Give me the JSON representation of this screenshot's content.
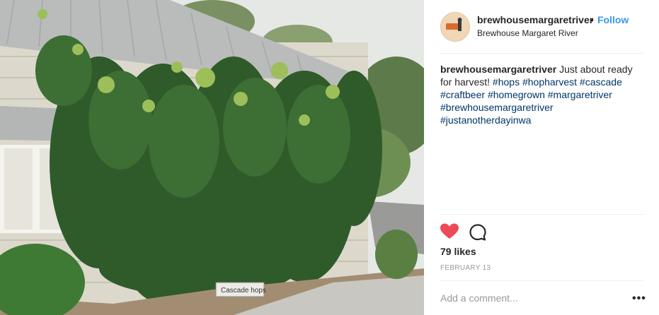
{
  "post": {
    "account": {
      "username": "brewhousemargaretriver",
      "separator": "•",
      "follow_label": "Follow",
      "location": "Brewhouse Margaret River",
      "avatar_icon": "brewhouse-logo-icon"
    },
    "caption": {
      "username": "brewhousemargaretriver",
      "text": "Just about ready for harvest!",
      "hashtags": [
        "#hops",
        "#hopharvest",
        "#cascade",
        "#craftbeer",
        "#homegrown",
        "#margaretriver",
        "#brewhousemargaretriver",
        "#justanotherdayinwa"
      ]
    },
    "actions": {
      "like_icon": "heart-filled-icon",
      "comment_icon": "comment-bubble-icon",
      "liked": true
    },
    "likes_label": "79 likes",
    "date_label": "FEBRUARY 13",
    "comment_box": {
      "placeholder": "Add a comment...",
      "more_label": "•••"
    },
    "photo": {
      "sign_text": "Cascade hops"
    },
    "colors": {
      "link": "#3897f0",
      "hashtag": "#003569",
      "heart": "#ed4956",
      "muted": "#999999",
      "divider": "#efefef"
    }
  }
}
